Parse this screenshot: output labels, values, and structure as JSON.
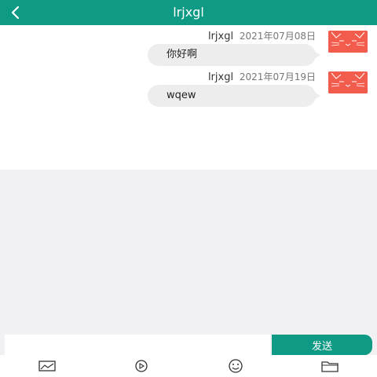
{
  "header": {
    "title": "lrjxgl",
    "back_icon": "back-arrow-icon",
    "background": "#0f9a86"
  },
  "messages": [
    {
      "sender": "lrjxgl",
      "date": "2021年07月08日",
      "text": "你好啊",
      "avatar_icon": "cat-avatar-icon"
    },
    {
      "sender": "lrjxgl",
      "date": "2021年07月19日",
      "text": "wqew",
      "avatar_icon": "cat-avatar-icon"
    }
  ],
  "composer": {
    "input_value": "",
    "input_placeholder": "",
    "send_label": "发送",
    "accent": "#0f9a86"
  },
  "toolbar": {
    "items": [
      {
        "icon": "image-icon"
      },
      {
        "icon": "video-play-icon"
      },
      {
        "icon": "emoji-icon"
      },
      {
        "icon": "folder-icon"
      }
    ]
  }
}
